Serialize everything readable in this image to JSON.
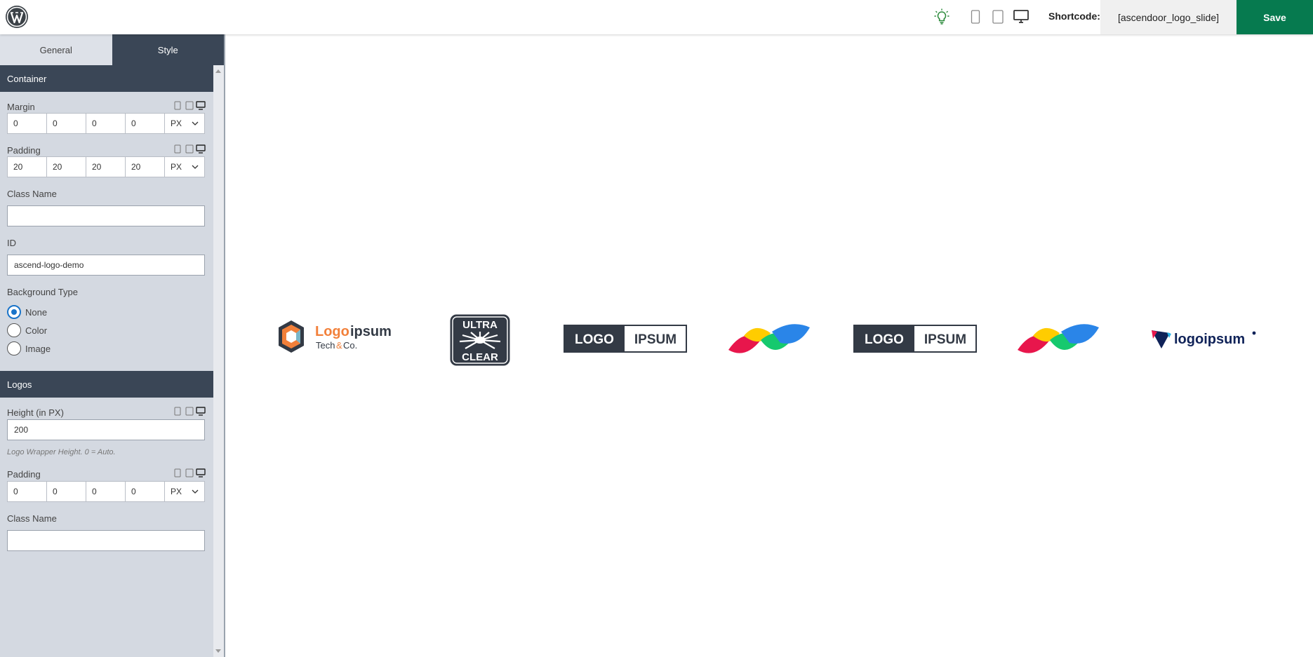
{
  "header": {
    "shortcode_label": "Shortcode:",
    "shortcode_value": "[ascendoor_logo_slide]",
    "save_label": "Save",
    "accent_color": "#067a4f",
    "icons": [
      "wordpress-logo-icon",
      "lightbulb-icon",
      "mobile-device-icon",
      "tablet-device-icon",
      "desktop-device-icon"
    ]
  },
  "sidebar": {
    "tabs": [
      {
        "label": "General",
        "active": false
      },
      {
        "label": "Style",
        "active": true
      }
    ],
    "container": {
      "title": "Container",
      "margin": {
        "label": "Margin",
        "values": [
          "0",
          "0",
          "0",
          "0"
        ],
        "unit": "PX"
      },
      "padding": {
        "label": "Padding",
        "values": [
          "20",
          "20",
          "20",
          "20"
        ],
        "unit": "PX"
      },
      "class_name": {
        "label": "Class Name",
        "value": ""
      },
      "id": {
        "label": "ID",
        "value": "ascend-logo-demo"
      },
      "background_type": {
        "label": "Background Type",
        "options": [
          "None",
          "Color",
          "Image"
        ],
        "selected": "None"
      }
    },
    "logos": {
      "title": "Logos",
      "height": {
        "label": "Height (in PX)",
        "value": "200",
        "hint": "Logo Wrapper Height. 0 = Auto."
      },
      "padding": {
        "label": "Padding",
        "values": [
          "0",
          "0",
          "0",
          "0"
        ],
        "unit": "PX"
      },
      "class_name": {
        "label": "Class Name",
        "value": ""
      }
    }
  },
  "canvas": {
    "logos": [
      {
        "type": "logoipsum-techco",
        "text_a": "Logo",
        "text_b": "ipsum",
        "tagline_a": "Tech",
        "tagline_amp": "&",
        "tagline_b": "Co."
      },
      {
        "type": "ultra-clear",
        "line1": "ULTRA",
        "line2": "CLEAR"
      },
      {
        "type": "logo-ipsum-box",
        "left": "LOGO",
        "right": "IPSUM"
      },
      {
        "type": "color-leaves"
      },
      {
        "type": "logo-ipsum-box",
        "left": "LOGO",
        "right": "IPSUM"
      },
      {
        "type": "color-leaves"
      },
      {
        "type": "logoipsum-wordmark",
        "text": "logoipsum"
      }
    ]
  }
}
